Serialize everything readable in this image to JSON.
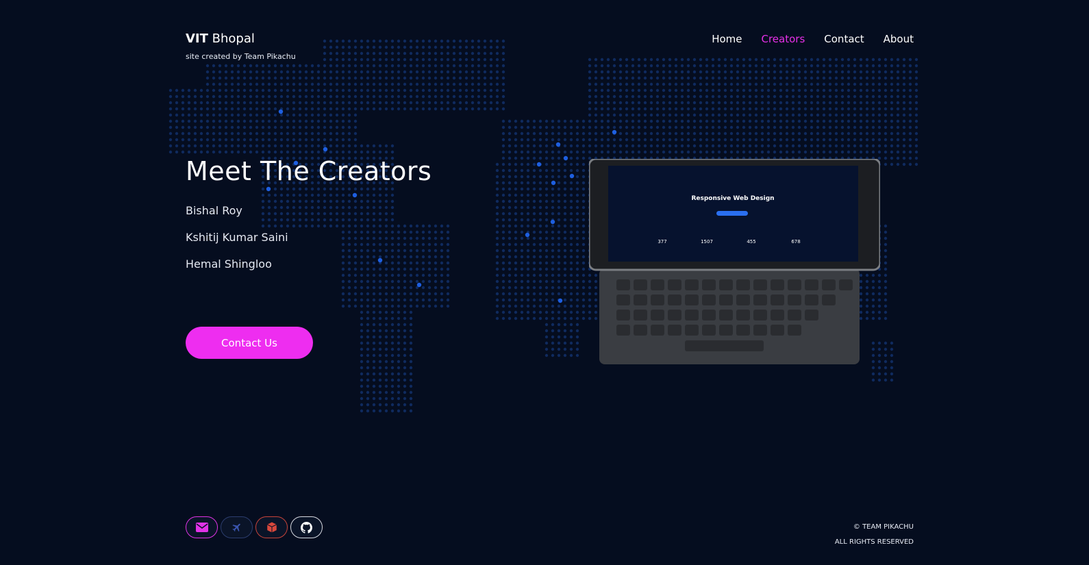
{
  "brand": {
    "bold": "VIT",
    "rest": " Bhopal",
    "tagline": "site created by Team Pikachu"
  },
  "nav": [
    {
      "label": "Home",
      "active": false
    },
    {
      "label": "Creators",
      "active": true
    },
    {
      "label": "Contact",
      "active": false
    },
    {
      "label": "About",
      "active": false
    }
  ],
  "hero": {
    "title": "Meet The Creators",
    "creators": [
      "Bishal Roy",
      "Kshitij Kumar Saini",
      "Hemal Shingloo"
    ],
    "cta_label": "Contact Us"
  },
  "device_screen": {
    "title": "Responsive Web Design",
    "stats": [
      "377",
      "1507",
      "455",
      "678"
    ]
  },
  "socials": [
    {
      "icon": "mail-icon",
      "color": "#e033e6"
    },
    {
      "icon": "plane-icon",
      "color": "#3b55b0"
    },
    {
      "icon": "box-icon",
      "color": "#d9483c"
    },
    {
      "icon": "github-icon",
      "color": "#ffffff"
    }
  ],
  "footer": {
    "copyright": "© TEAM PIKACHU",
    "rights": "ALL RIGHTS RESERVED"
  },
  "colors": {
    "background": "#050d1f",
    "accent": "#ee2df0",
    "map_dot": "#0f2a5e",
    "map_highlight": "#1e5fe0"
  }
}
